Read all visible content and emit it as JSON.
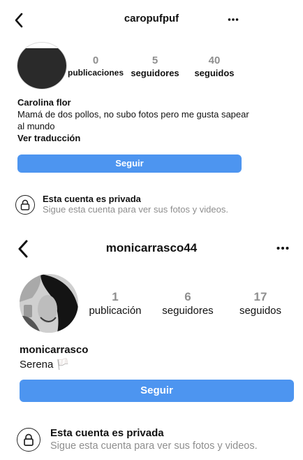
{
  "profile1": {
    "username": "caropufpuf",
    "stats": [
      {
        "value": "0",
        "label": "publicaciones"
      },
      {
        "value": "5",
        "label": "seguidores"
      },
      {
        "value": "40",
        "label": "seguidos"
      }
    ],
    "display_name": "Carolina flor",
    "bio": "Mamá de dos pollos, no subo fotos pero me gusta sapear al mundo",
    "translate_link": "Ver traducción",
    "follow_button": "Seguir",
    "private_title": "Esta cuenta es privada",
    "private_subtitle": "Sigue esta cuenta para ver sus fotos y videos."
  },
  "profile2": {
    "username": "monicarrasco44",
    "stats": [
      {
        "value": "1",
        "label": "publicación"
      },
      {
        "value": "6",
        "label": "seguidores"
      },
      {
        "value": "17",
        "label": "seguidos"
      }
    ],
    "display_name": "monicarrasco",
    "bio": "Serena 🏳️",
    "follow_button": "Seguir",
    "private_title": "Esta cuenta es privada",
    "private_subtitle": "Sigue esta cuenta para ver sus fotos y videos."
  },
  "icons": {
    "back": "chevron-left-icon",
    "more": "more-horizontal-icon",
    "lock": "lock-icon"
  },
  "colors": {
    "accent": "#4d95f0",
    "muted": "#8e8e8e"
  }
}
